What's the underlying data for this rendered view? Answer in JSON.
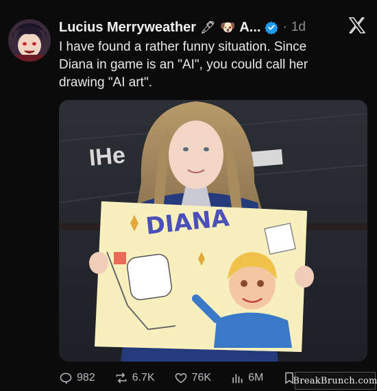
{
  "tweet": {
    "author_name": "Lucius Merryweather",
    "author_suffix": "A...",
    "separator": "·",
    "time": "1d",
    "text_line1": "I have found a rather funny situation. Since",
    "text_line2": "Diana in game is an \"AI\", you could call her",
    "text_line3": "drawing \"AI art\"."
  },
  "icons": {
    "author_emoji_1": "🖋",
    "author_emoji_2": "🐶",
    "verified": "verified-icon",
    "platform": "x-logo-icon"
  },
  "media": {
    "sign_text": "DIANA",
    "backdrop_text": "IHe"
  },
  "actions": {
    "replies": "982",
    "reposts": "6.7K",
    "likes": "76K",
    "views": "6M"
  },
  "watermark": "BreakBrunch.com",
  "colors": {
    "background": "#0b0b0c",
    "verified": "#1d9bf0",
    "muted": "#8b8f94"
  }
}
